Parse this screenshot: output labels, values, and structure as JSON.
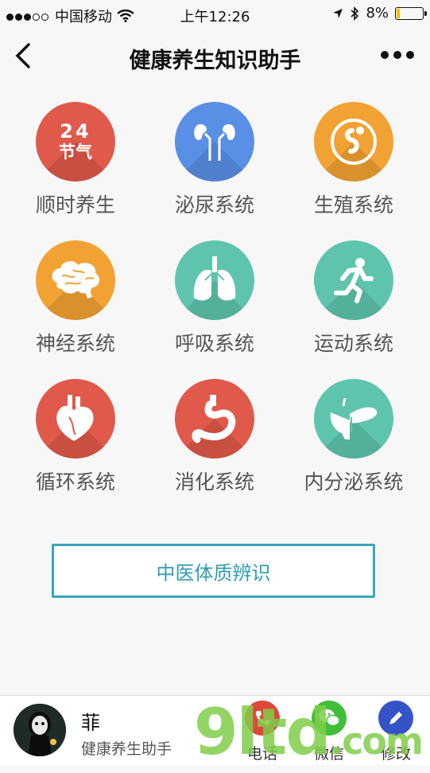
{
  "status_bar": {
    "carrier": "中国移动",
    "time": "上午12:26",
    "battery": "8%"
  },
  "nav": {
    "title": "健康养生知识助手"
  },
  "colors": {
    "red": "#e0594a",
    "blue": "#5a8fe6",
    "orange": "#f2a233",
    "teal": "#5fc4ad",
    "accent": "#3aa6bb"
  },
  "grid": [
    {
      "label": "顺时养生",
      "icon": "solar-terms-24-icon",
      "color": "#e0594a",
      "badge_top": "24",
      "badge_bottom": "节气"
    },
    {
      "label": "泌尿系统",
      "icon": "kidneys-icon",
      "color": "#5a8fe6"
    },
    {
      "label": "生殖系统",
      "icon": "reproductive-icon",
      "color": "#f2a233"
    },
    {
      "label": "神经系统",
      "icon": "brain-icon",
      "color": "#f2a233"
    },
    {
      "label": "呼吸系统",
      "icon": "lungs-icon",
      "color": "#5fc4ad"
    },
    {
      "label": "运动系统",
      "icon": "runner-icon",
      "color": "#5fc4ad"
    },
    {
      "label": "循环系统",
      "icon": "heart-icon",
      "color": "#e0594a"
    },
    {
      "label": "消化系统",
      "icon": "stomach-icon",
      "color": "#e0594a"
    },
    {
      "label": "内分泌系统",
      "icon": "pancreas-icon",
      "color": "#5fc4ad"
    }
  ],
  "tcm_button": "中医体质辨识",
  "footer": {
    "name": "菲",
    "subtitle": "健康养生助手",
    "actions": [
      {
        "label": "电话",
        "icon": "phone-icon",
        "color": "#e0453a"
      },
      {
        "label": "微信",
        "icon": "wechat-icon",
        "color": "#3fbf3a"
      },
      {
        "label": "修改",
        "icon": "pencil-icon",
        "color": "#3652c9"
      }
    ]
  },
  "watermark": {
    "main": "9ltd",
    "suffix": ".com"
  }
}
